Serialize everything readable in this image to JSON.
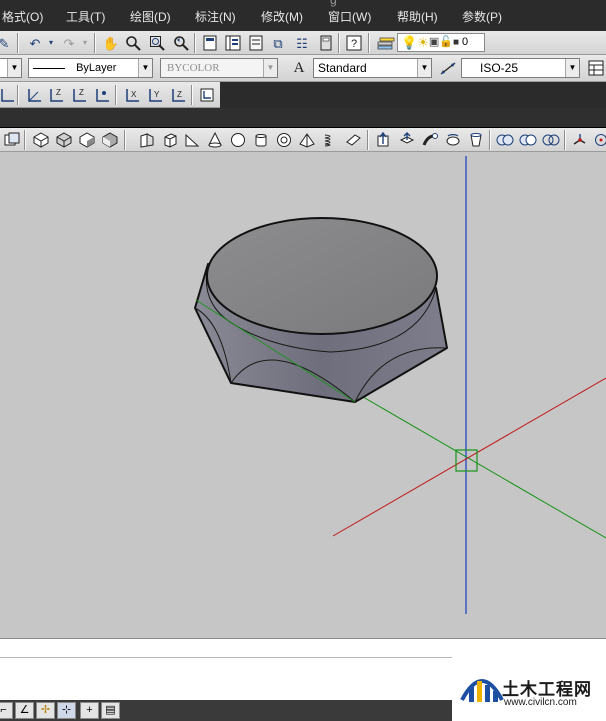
{
  "window": {
    "title_fragment": "g"
  },
  "menu": {
    "items": [
      {
        "label": "格式(O)"
      },
      {
        "label": "工具(T)"
      },
      {
        "label": "绘图(D)"
      },
      {
        "label": "标注(N)"
      },
      {
        "label": "修改(M)"
      },
      {
        "label": "窗口(W)"
      },
      {
        "label": "帮助(H)"
      },
      {
        "label": "参数(P)"
      }
    ]
  },
  "standard_toolbar": {
    "layer_value": "0"
  },
  "properties_toolbar": {
    "linetype": "ByLayer",
    "color": "BYCOLOR",
    "text_style": "Standard",
    "dim_style": "ISO-25"
  },
  "viewport": {
    "axis_colors": {
      "x": "#c01818",
      "y": "#189418",
      "z": "#1a3fbf"
    },
    "object": "hex-nut-solid"
  },
  "watermark": {
    "name": "土木工程网",
    "url": "www.civilcn.com"
  },
  "colors": {
    "menubar": "#2b2b2b",
    "toolbar": "#e0e0e0",
    "viewport": "#c6c6c6",
    "solid_fill": "#7c7c88"
  }
}
